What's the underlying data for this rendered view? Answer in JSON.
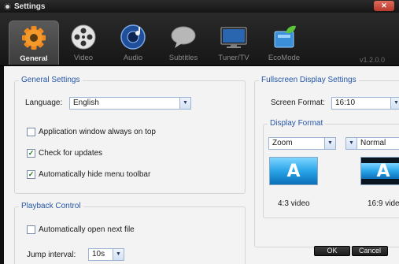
{
  "window": {
    "title": "Settings",
    "close_label": "✕"
  },
  "tabs": [
    {
      "label": "General",
      "icon": "gear-icon",
      "active": true
    },
    {
      "label": "Video",
      "icon": "film-reel-icon",
      "active": false
    },
    {
      "label": "Audio",
      "icon": "speaker-icon",
      "active": false
    },
    {
      "label": "Subtitles",
      "icon": "speech-bubble-icon",
      "active": false
    },
    {
      "label": "Tuner/TV",
      "icon": "tv-monitor-icon",
      "active": false
    },
    {
      "label": "EcoMode",
      "icon": "battery-leaf-icon",
      "active": false
    }
  ],
  "version": "v1.2.0.0",
  "general": {
    "legend": "General Settings",
    "language_label": "Language:",
    "language_value": "English",
    "options": [
      {
        "label": "Application window always on top",
        "checked": false
      },
      {
        "label": "Check for updates",
        "checked": true
      },
      {
        "label": "Automatically hide menu toolbar",
        "checked": true
      }
    ]
  },
  "playback": {
    "legend": "Playback Control",
    "auto_open_label": "Automatically open next file",
    "auto_open_checked": false,
    "jump_label": "Jump interval:",
    "jump_value": "10s"
  },
  "fullscreen": {
    "legend": "Fullscreen Display Settings",
    "screen_format_label": "Screen Format:",
    "screen_format_value": "16:10",
    "display_format_legend": "Display Format",
    "format_left_value": "Zoom",
    "format_right_value": "Normal",
    "preview_letter": "A",
    "caption_left": "4:3 video",
    "caption_right": "16:9 video"
  },
  "buttons": {
    "ok": "OK",
    "cancel": "Cancel"
  },
  "colors": {
    "accent_blue": "#2456a6",
    "check_green": "#1f7a1f",
    "toolbar_bg": "#1a1a1a"
  }
}
